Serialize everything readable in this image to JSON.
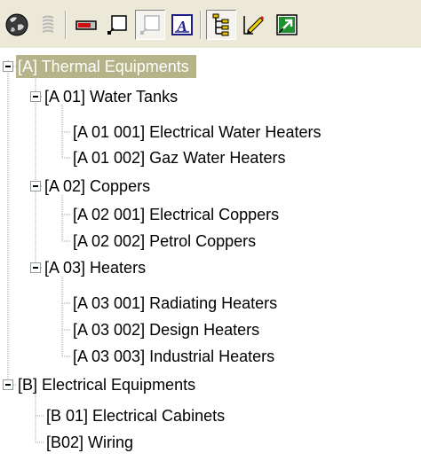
{
  "toolbar": {
    "buttons": [
      {
        "icon": "globe-icon",
        "pressed": false
      },
      {
        "icon": "coil-icon",
        "pressed": false
      },
      {
        "icon": "battery-icon",
        "pressed": false
      },
      {
        "icon": "window-icon",
        "pressed": false
      },
      {
        "icon": "window-disabled-icon",
        "pressed": true
      },
      {
        "icon": "text-style-icon",
        "pressed": false
      },
      {
        "icon": "tree-view-icon",
        "pressed": true
      },
      {
        "icon": "pen-edit-icon",
        "pressed": false
      },
      {
        "icon": "export-icon",
        "pressed": false
      }
    ]
  },
  "tree": {
    "nodes": [
      {
        "label": "[A] Thermal Equipments",
        "selected": true
      },
      {
        "label": "[A 01] Water Tanks"
      },
      {
        "label": "[A 01 001] Electrical Water Heaters"
      },
      {
        "label": "[A 01 002] Gaz Water Heaters"
      },
      {
        "label": "[A 02] Coppers"
      },
      {
        "label": "[A 02 001] Electrical Coppers"
      },
      {
        "label": "[A 02 002] Petrol Coppers"
      },
      {
        "label": "[A 03] Heaters"
      },
      {
        "label": "[A 03 001] Radiating Heaters"
      },
      {
        "label": "[A 03 002] Design Heaters"
      },
      {
        "label": "[A 03 003] Industrial Heaters"
      },
      {
        "label": "[B] Electrical Equipments"
      },
      {
        "label": "[B 01] Electrical Cabinets"
      },
      {
        "label": "[B02] Wiring"
      }
    ]
  },
  "colors": {
    "selection": "#b4b38a",
    "toolbar_bg": "#ece9d8",
    "tree_line": "#a0a0a0"
  }
}
